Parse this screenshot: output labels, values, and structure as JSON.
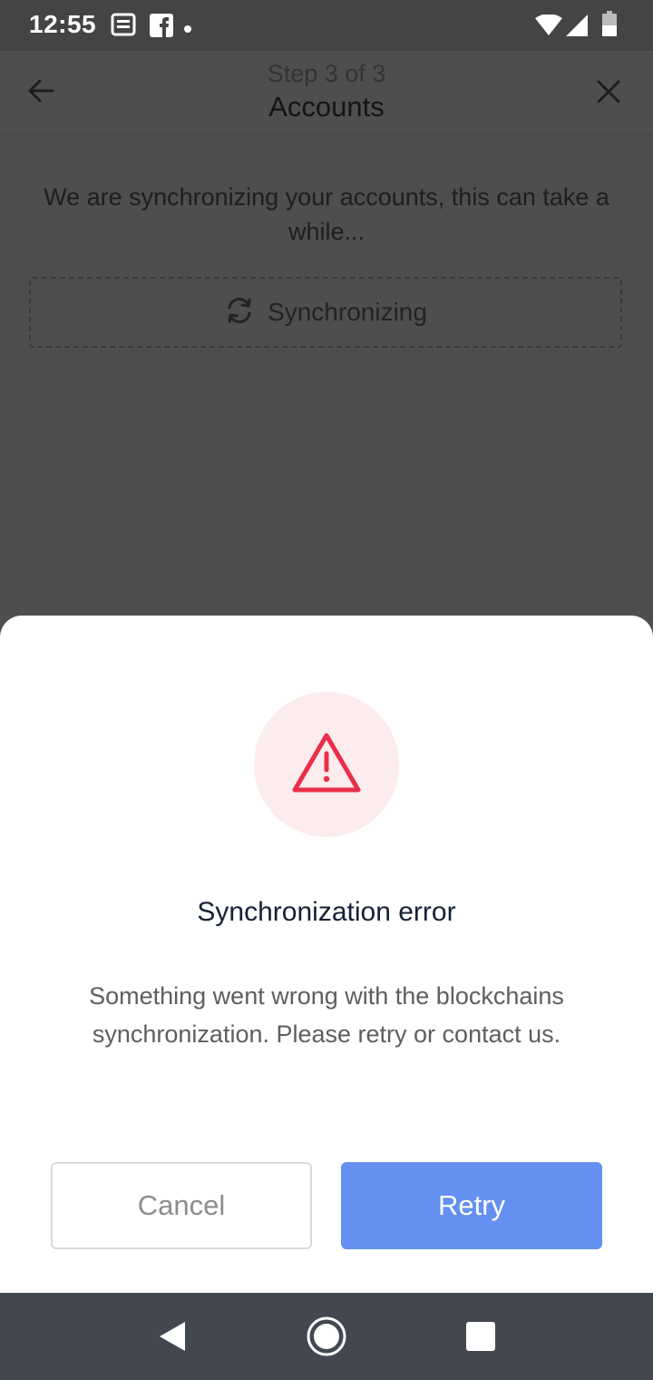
{
  "status_bar": {
    "time": "12:55",
    "icons": [
      "news-icon",
      "facebook-icon",
      "notification-dot-icon",
      "wifi-icon",
      "signal-icon",
      "battery-icon"
    ]
  },
  "header": {
    "step": "Step 3 of 3",
    "title": "Accounts",
    "icons": {
      "back": "arrow-left-icon",
      "close": "close-icon"
    }
  },
  "content": {
    "message": "We are synchronizing your accounts, this can take a while...",
    "sync_status": "Synchronizing",
    "sync_icon": "refresh-icon"
  },
  "modal": {
    "icon": "warning-icon",
    "title": "Synchronization error",
    "description": "Something went wrong with the blockchains synchronization.  Please retry or contact us.",
    "cancel_label": "Cancel",
    "retry_label": "Retry"
  },
  "nav": {
    "icons": [
      "back-triangle-icon",
      "home-circle-icon",
      "recents-square-icon"
    ]
  },
  "colors": {
    "accent": "#6490f1",
    "warning": "#ea2e49",
    "warning_bg": "#fdecee",
    "overlay": "#4e4e4e"
  }
}
